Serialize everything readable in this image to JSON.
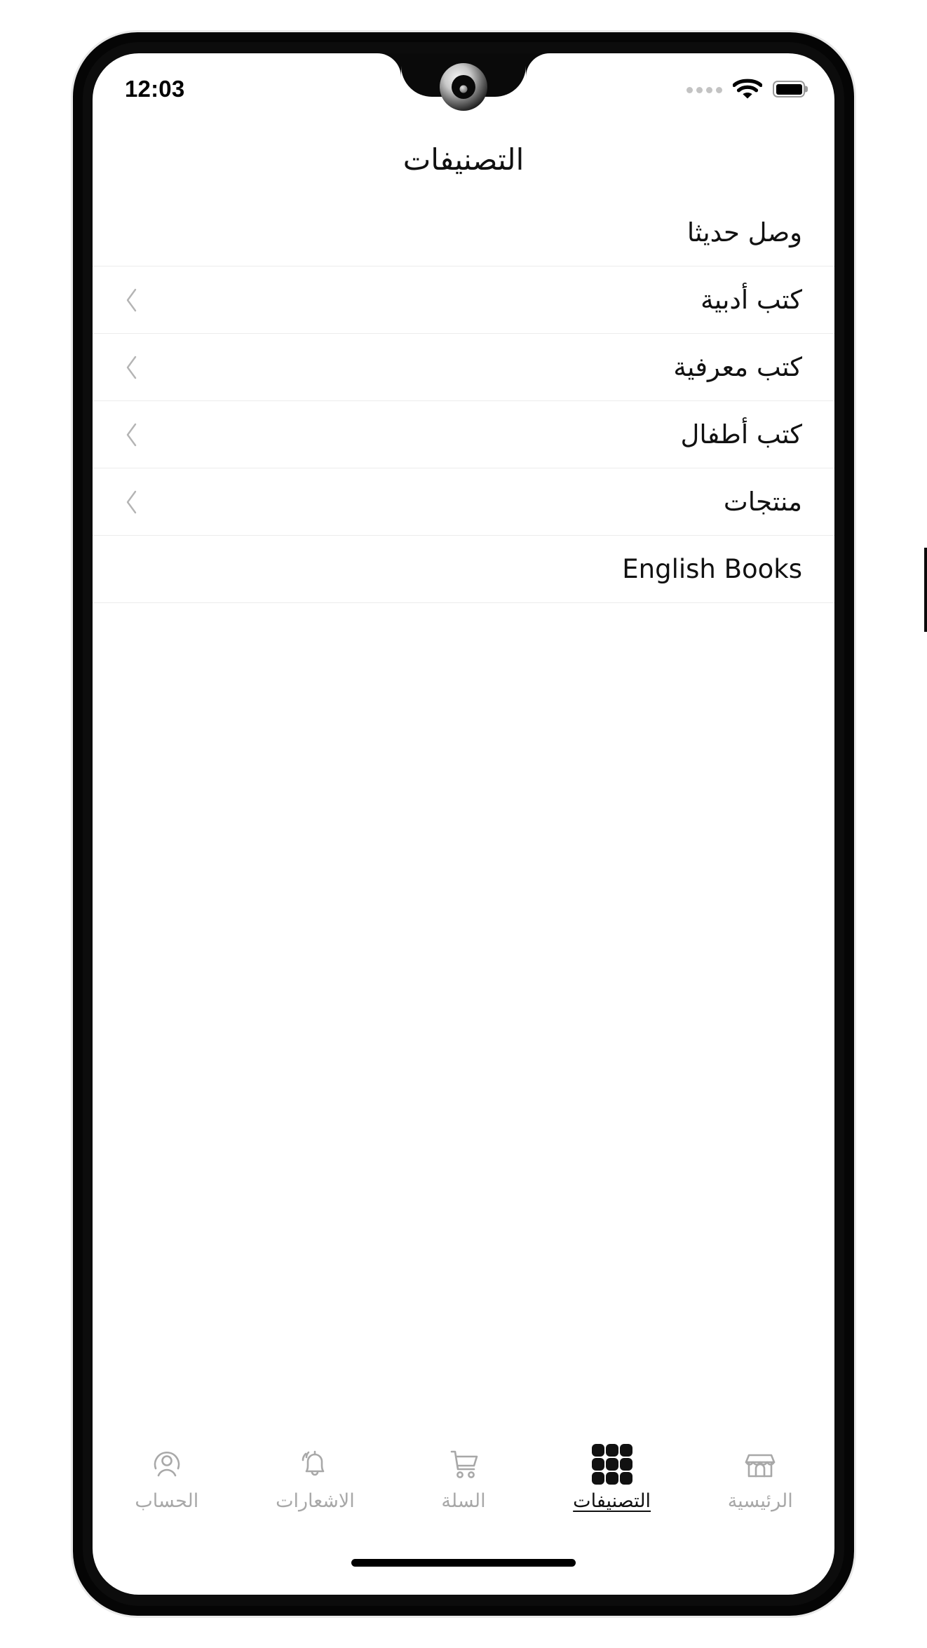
{
  "status_bar": {
    "time": "12:03",
    "signal_icon": "signal-dots-icon",
    "wifi_icon": "wifi-icon",
    "battery_icon": "battery-icon",
    "signal_dot_count": 4
  },
  "header": {
    "title": "التصنيفات"
  },
  "categories": [
    {
      "label": "وصل حديثا",
      "has_chevron": false
    },
    {
      "label": "كتب أدبية",
      "has_chevron": true
    },
    {
      "label": "كتب معرفية",
      "has_chevron": true
    },
    {
      "label": "كتب أطفال",
      "has_chevron": true
    },
    {
      "label": "منتجات",
      "has_chevron": true
    },
    {
      "label": "English Books",
      "has_chevron": false
    }
  ],
  "chevron_icon": "chevron-left-icon",
  "bottom_nav": [
    {
      "label": "الرئيسية",
      "icon": "store-icon",
      "active": false
    },
    {
      "label": "التصنيفات",
      "icon": "grid-dots-icon",
      "active": true
    },
    {
      "label": "السلة",
      "icon": "cart-icon",
      "active": false
    },
    {
      "label": "الاشعارات",
      "icon": "bell-icon",
      "active": false
    },
    {
      "label": "الحساب",
      "icon": "user-circle-icon",
      "active": false
    }
  ],
  "colors": {
    "text_primary": "#111111",
    "text_muted": "#a8a8a8",
    "divider": "#ececec",
    "chevron": "#b4b4b4",
    "background": "#ffffff",
    "frame": "#050505"
  }
}
